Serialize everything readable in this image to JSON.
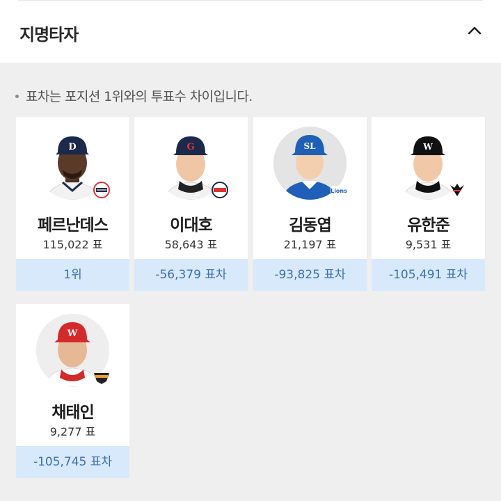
{
  "section": {
    "title": "지명타자",
    "collapse_icon": "chevron-up-icon"
  },
  "note": "표차는 포지션 1위와의 투표수 차이입니다.",
  "colors": {
    "diff_bg": "#d7e9fb",
    "diff_text": "#3b6fb0",
    "card_bg": "#ffffff",
    "page_bg": "#efefef"
  },
  "players": [
    {
      "name": "페르난데스",
      "votes": "115,022 표",
      "diff": "1위",
      "team_logo": "bears-logo-icon"
    },
    {
      "name": "이대호",
      "votes": "58,643 표",
      "diff": "-56,379 표차",
      "team_logo": "giants-logo-icon"
    },
    {
      "name": "김동엽",
      "votes": "21,197 표",
      "diff": "-93,825 표차",
      "team_logo": "lions-logo-icon"
    },
    {
      "name": "유한준",
      "votes": "9,531 표",
      "diff": "-105,491 표차",
      "team_logo": "kt-wiz-logo-icon"
    },
    {
      "name": "채태인",
      "votes": "9,277 표",
      "diff": "-105,745 표차",
      "team_logo": "wyverns-logo-icon"
    }
  ]
}
